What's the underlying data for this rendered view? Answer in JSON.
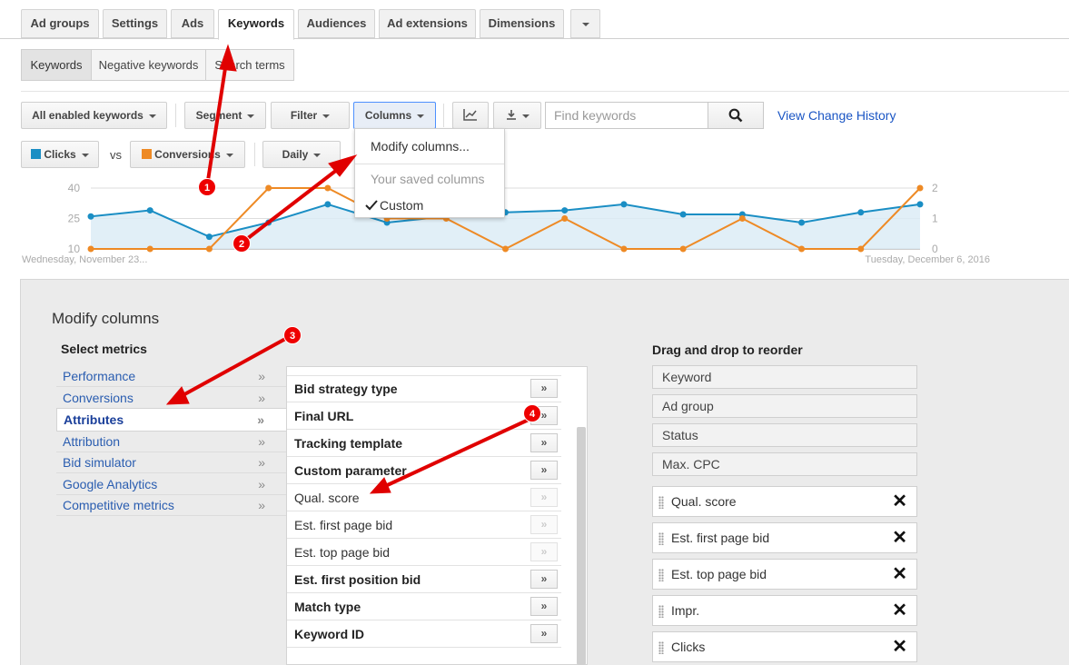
{
  "top_tabs": [
    {
      "label": "Ad groups"
    },
    {
      "label": "Settings"
    },
    {
      "label": "Ads"
    },
    {
      "label": "Keywords"
    },
    {
      "label": "Audiences"
    },
    {
      "label": "Ad extensions"
    },
    {
      "label": "Dimensions"
    }
  ],
  "sub_tabs": [
    {
      "label": "Keywords"
    },
    {
      "label": "Negative keywords"
    },
    {
      "label": "Search terms"
    }
  ],
  "toolbar": {
    "all_keywords": "All enabled keywords",
    "segment": "Segment",
    "filter": "Filter",
    "columns": "Columns",
    "search_placeholder": "Find keywords",
    "view_history": "View Change History"
  },
  "chart_controls": {
    "metric1": "Clicks",
    "vs": "vs",
    "metric2": "Conversions",
    "interval": "Daily"
  },
  "columns_menu": {
    "modify": "Modify columns...",
    "saved": "Your saved columns",
    "custom": "Custom"
  },
  "colors": {
    "clicks": "#1a8ec4",
    "conversions": "#ee8a25",
    "accent_link": "#1a55c4",
    "annotation": "#e00000"
  },
  "chart_data": {
    "type": "line",
    "x": [
      "Wednesday, November 23...",
      "",
      "",
      "",
      "",
      "",
      "",
      "",
      "",
      "",
      "",
      "",
      "",
      "",
      "Tuesday, December 6, 2016"
    ],
    "series": [
      {
        "name": "Clicks",
        "axis": "left",
        "values": [
          26,
          29,
          16,
          23,
          32,
          23,
          26,
          28,
          29,
          32,
          27,
          27,
          23,
          28,
          32
        ]
      },
      {
        "name": "Conversions",
        "axis": "right",
        "values": [
          0,
          0,
          0,
          2,
          2,
          1,
          1,
          0,
          1,
          0,
          0,
          1,
          0,
          0,
          2
        ]
      }
    ],
    "y_left_ticks": [
      40,
      25,
      10
    ],
    "y_right_ticks": [
      2,
      1,
      0
    ],
    "ylim_left": [
      10,
      40
    ],
    "ylim_right": [
      0,
      2
    ],
    "start_label": "Wednesday, November 23...",
    "end_label": "Tuesday, December 6, 2016",
    "grid": true
  },
  "panel": {
    "title": "Modify columns",
    "select_metrics": "Select metrics",
    "reorder_title": "Drag and drop to reorder"
  },
  "metric_categories": [
    {
      "label": "Performance",
      "arrow": "»"
    },
    {
      "label": "Conversions",
      "arrow": "»"
    },
    {
      "label": "Attributes",
      "arrow": "»"
    },
    {
      "label": "Attribution",
      "arrow": "»"
    },
    {
      "label": "Bid simulator",
      "arrow": "»"
    },
    {
      "label": "Google Analytics",
      "arrow": "»"
    },
    {
      "label": "Competitive metrics",
      "arrow": "»"
    }
  ],
  "attribute_metrics": [
    {
      "label": "Bid strategy type",
      "added": false,
      "btn": "»"
    },
    {
      "label": "Final URL",
      "added": false,
      "btn": "»"
    },
    {
      "label": "Tracking template",
      "added": false,
      "btn": "»"
    },
    {
      "label": "Custom parameter",
      "added": false,
      "btn": "»"
    },
    {
      "label": "Qual. score",
      "added": true,
      "btn": "»"
    },
    {
      "label": "Est. first page bid",
      "added": true,
      "btn": "»"
    },
    {
      "label": "Est. top page bid",
      "added": true,
      "btn": "»"
    },
    {
      "label": "Est. first position bid",
      "added": false,
      "btn": "»"
    },
    {
      "label": "Match type",
      "added": false,
      "btn": "»"
    },
    {
      "label": "Keyword ID",
      "added": false,
      "btn": "»"
    }
  ],
  "fixed_columns": [
    {
      "label": "Keyword"
    },
    {
      "label": "Ad group"
    },
    {
      "label": "Status"
    },
    {
      "label": "Max. CPC"
    }
  ],
  "selected_columns": [
    {
      "label": "Qual. score",
      "close": "✕"
    },
    {
      "label": "Est. first page bid",
      "close": "✕"
    },
    {
      "label": "Est. top page bid",
      "close": "✕"
    },
    {
      "label": "Impr.",
      "close": "✕"
    },
    {
      "label": "Clicks",
      "close": "✕"
    }
  ],
  "annotations": [
    "1",
    "2",
    "3",
    "4"
  ]
}
